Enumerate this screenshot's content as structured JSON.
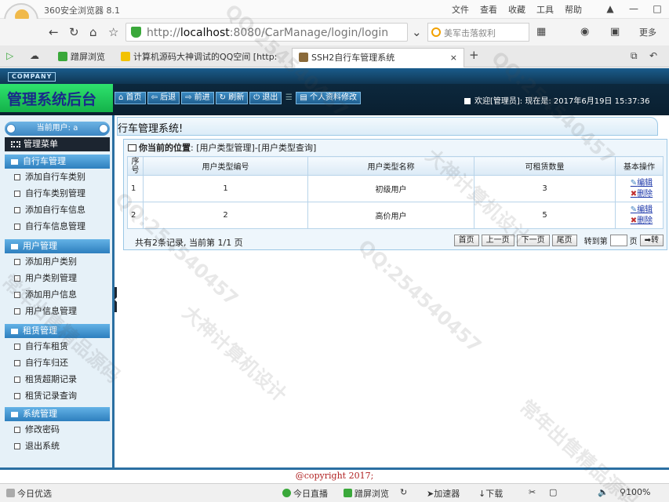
{
  "browser": {
    "title": "360安全浏览器 8.1",
    "menu": [
      "文件",
      "查看",
      "收藏",
      "工具",
      "帮助"
    ],
    "url_prefix": "http://",
    "url_host": "localhost",
    "url_rest": ":8080/CarManage/login/login",
    "search_placeholder": "美军击落叙利",
    "more_label": "更多",
    "tabs": [
      "蹭屏浏览",
      "计算机源码大神调试的QQ空间 [http:",
      "SSH2自行车管理系统"
    ],
    "tab_close": "×",
    "new_tab": "+",
    "colors": {
      "secure": "#3aa83a",
      "tab_green": "#3aa83a"
    }
  },
  "app": {
    "company": "COMPANY",
    "logo": "管理系统后台",
    "nav": [
      "首页",
      "后退",
      "前进",
      "刷新",
      "退出",
      "个人资料修改"
    ],
    "nav_icons": [
      "home-icon",
      "back-arrow-icon",
      "forward-arrow-icon",
      "refresh-icon",
      "power-icon",
      "profile-icon"
    ],
    "welcome": "欢迎[管理员]: 现在是: 2017年6月19日 15:37:36"
  },
  "sidebar": {
    "current_user": "当前用户: a",
    "menu_title": "管理菜单",
    "groups": [
      {
        "title": "自行车管理",
        "items": [
          "添加自行车类别",
          "自行车类别管理",
          "添加自行车信息",
          "自行车信息管理"
        ]
      },
      {
        "title": "用户管理",
        "items": [
          "添加用户类别",
          "用户类别管理",
          "添加用户信息",
          "用户信息管理"
        ]
      },
      {
        "title": "租赁管理",
        "items": [
          "自行车租赁",
          "自行车归还",
          "租赁超期记录",
          "租赁记录查询"
        ]
      },
      {
        "title": "系统管理",
        "items": [
          "修改密码",
          "退出系统"
        ]
      }
    ]
  },
  "main": {
    "title": "行车管理系统!",
    "crumb_label": "你当前的位置",
    "crumb_path": ": [用户类型管理]-[用户类型查询]",
    "headers": {
      "seq": "序号",
      "code": "用户类型编号",
      "name": "用户类型名称",
      "count": "可租赁数量",
      "ops": "基本操作"
    },
    "rows": [
      {
        "seq": "1",
        "code": "1",
        "name": "初级用户",
        "count": "3",
        "edit": "编辑",
        "delete": "删除"
      },
      {
        "seq": "2",
        "code": "2",
        "name": "高价用户",
        "count": "5",
        "edit": "编辑",
        "delete": "删除"
      }
    ],
    "pager": {
      "info": "共有2条记录, 当前第 1/1 页",
      "first": "首页",
      "prev": "上一页",
      "next": "下一页",
      "last": "尾页",
      "goto": "转到第",
      "page_unit": "页",
      "go": "➡转"
    }
  },
  "footer": {
    "copyright": "@copyright 2017;"
  },
  "status": {
    "left": "今日优选",
    "items": [
      "今日直播",
      "蹭屏浏览",
      "加速器",
      "下载"
    ],
    "zoom": "100%"
  },
  "watermark": {
    "a": "QQ:254540457",
    "b": "大神计算机设计",
    "c": "常年出售精品源码"
  }
}
